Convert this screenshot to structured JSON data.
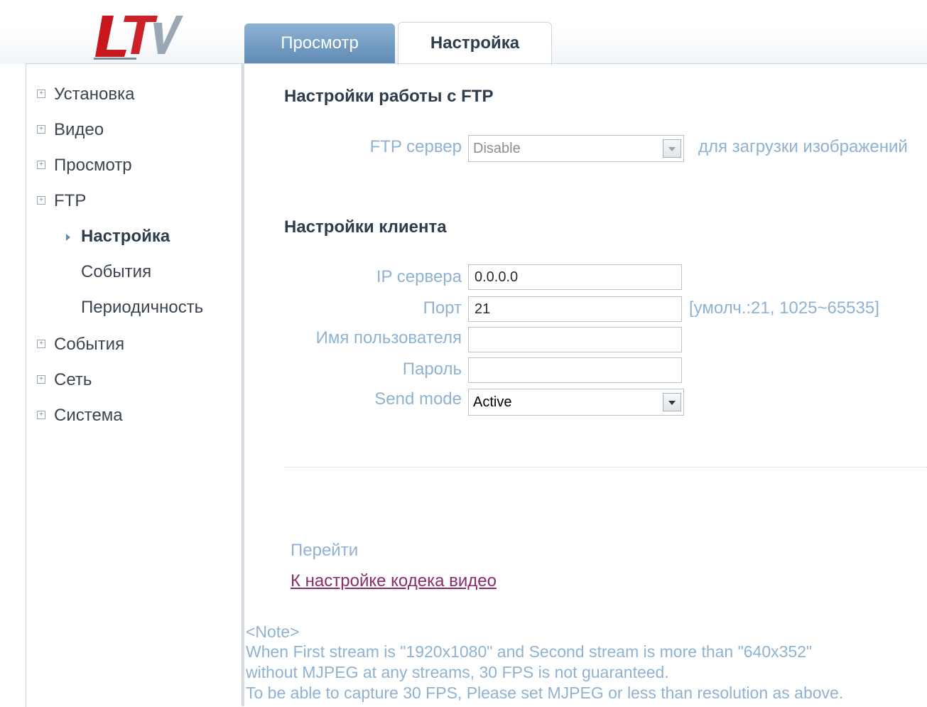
{
  "logo": {
    "text": "LTV",
    "colors": {
      "primary": "#c8161d",
      "secondary": "#9aa8b6"
    }
  },
  "tabs": [
    {
      "label": "Просмотр",
      "active": false
    },
    {
      "label": "Настройка",
      "active": true
    }
  ],
  "sidebar": {
    "items": [
      {
        "label": "Установка"
      },
      {
        "label": "Видео"
      },
      {
        "label": "Просмотр"
      },
      {
        "label": "FTP"
      },
      {
        "label": "События"
      },
      {
        "label": "Сеть"
      },
      {
        "label": "Система"
      }
    ],
    "ftp_sub": [
      {
        "label": "Настройка",
        "active": true
      },
      {
        "label": "События",
        "active": false
      },
      {
        "label": "Периодичность",
        "active": false
      }
    ]
  },
  "ftp_section": {
    "title": "Настройки работы с FTP",
    "server_label": "FTP сервер",
    "server_value": "Disable",
    "server_hint": "для загрузки изображений"
  },
  "client_section": {
    "title": "Настройки клиента",
    "ip_label": "IP сервера",
    "ip_value": "0.0.0.0",
    "port_label": "Порт",
    "port_value": "21",
    "port_hint": "[умолч.:21, 1025~65535]",
    "user_label": "Имя пользователя",
    "user_value": "",
    "pass_label": "Пароль",
    "pass_value": "",
    "mode_label": "Send mode",
    "mode_value": "Active"
  },
  "goto": {
    "label": "Перейти",
    "link": "К настройке кодека видео"
  },
  "note": {
    "title": "<Note>",
    "line1": "When First stream is \"1920x1080\" and Second stream is more than \"640x352\"",
    "line2": "without MJPEG at any streams, 30 FPS is not guaranteed.",
    "line3": "To be able to capture 30 FPS, Please set MJPEG or less than resolution as above."
  }
}
